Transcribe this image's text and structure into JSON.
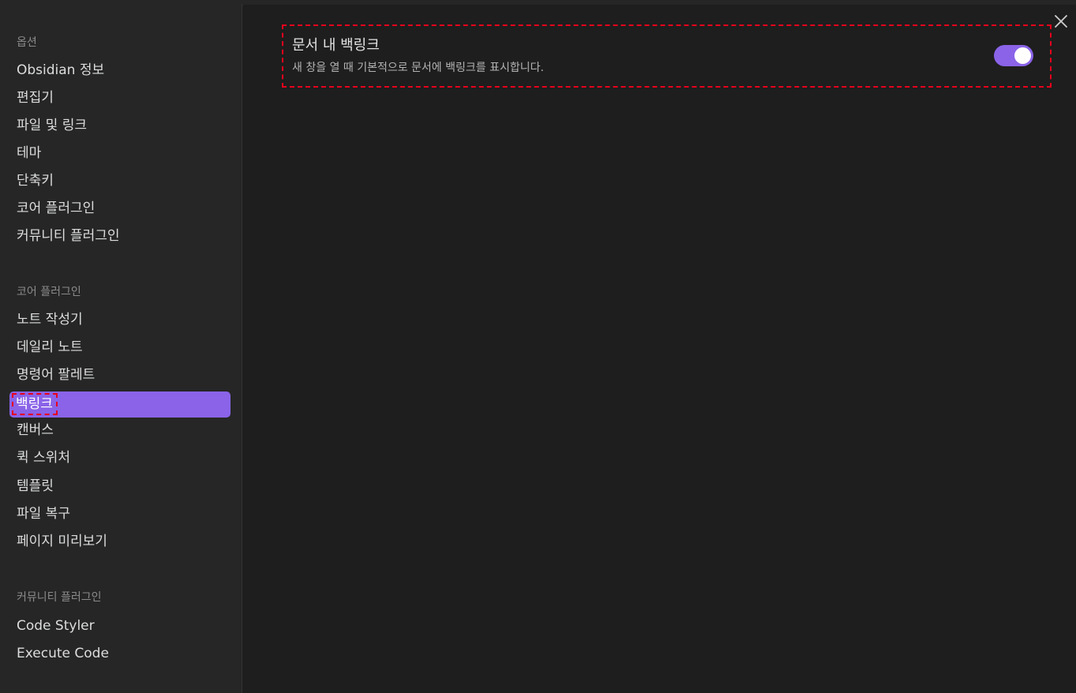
{
  "colors": {
    "accent": "#8a63e8",
    "highlight": "#e8001c",
    "sidebar_bg": "#262626",
    "content_bg": "#1e1e1e"
  },
  "sidebar": {
    "sections": [
      {
        "title": "옵션",
        "items": [
          {
            "label": "Obsidian 정보"
          },
          {
            "label": "편집기"
          },
          {
            "label": "파일 및 링크"
          },
          {
            "label": "테마"
          },
          {
            "label": "단축키"
          },
          {
            "label": "코어 플러그인"
          },
          {
            "label": "커뮤니티 플러그인"
          }
        ]
      },
      {
        "title": "코어 플러그인",
        "items": [
          {
            "label": "노트 작성기"
          },
          {
            "label": "데일리 노트"
          },
          {
            "label": "명령어 팔레트"
          },
          {
            "label": "백링크"
          },
          {
            "label": "캔버스"
          },
          {
            "label": "퀵 스위처"
          },
          {
            "label": "템플릿"
          },
          {
            "label": "파일 복구"
          },
          {
            "label": "페이지 미리보기"
          }
        ]
      },
      {
        "title": "커뮤니티 플러그인",
        "items": [
          {
            "label": "Code Styler"
          },
          {
            "label": "Execute Code"
          }
        ]
      }
    ],
    "active_item": "백링크"
  },
  "content": {
    "close_icon": "close-icon",
    "setting": {
      "name": "문서 내 백링크",
      "description": "새 창을 열 때 기본적으로 문서에 백링크를 표시합니다.",
      "enabled": true
    }
  }
}
